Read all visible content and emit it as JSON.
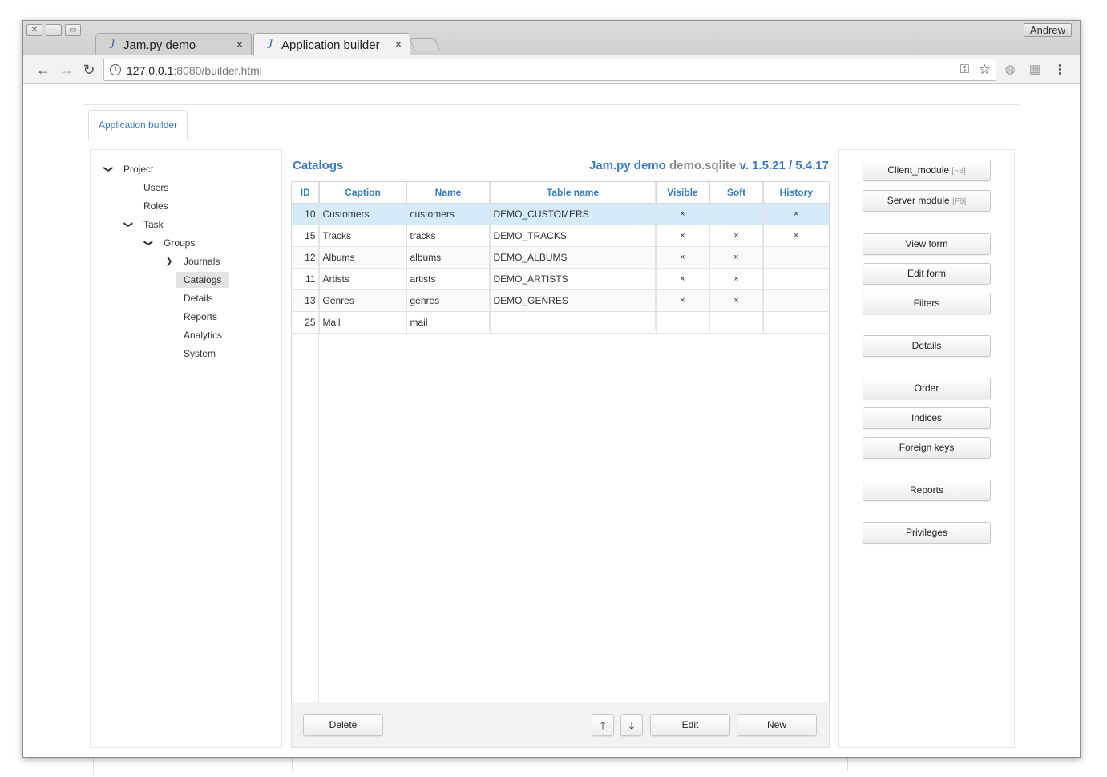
{
  "browser": {
    "profile_name": "Andrew",
    "tabs": [
      {
        "icon": "J",
        "title": "Jam.py demo",
        "close": "×"
      },
      {
        "icon": "J",
        "title": "Application builder",
        "close": "×"
      }
    ],
    "url_host": "127.0.0.1",
    "url_rest": ":8080/builder.html"
  },
  "app": {
    "tab_label": "Application builder",
    "tree": {
      "project": "Project",
      "users": "Users",
      "roles": "Roles",
      "task": "Task",
      "groups": "Groups",
      "journals": "Journals",
      "catalogs": "Catalogs",
      "details": "Details",
      "reports": "Reports",
      "analytics": "Analytics",
      "system": "System"
    },
    "center": {
      "title": "Catalogs",
      "project_name": "Jam.py demo",
      "db_name": "demo.sqlite",
      "version": "v. 1.5.21 / 5.4.17"
    },
    "table": {
      "columns": [
        "ID",
        "Caption",
        "Name",
        "Table name",
        "Visible",
        "Soft",
        "History"
      ],
      "rows": [
        {
          "id": "10",
          "caption": "Customers",
          "name": "customers",
          "table_name": "DEMO_CUSTOMERS",
          "visible": "×",
          "soft": "",
          "history": "×"
        },
        {
          "id": "15",
          "caption": "Tracks",
          "name": "tracks",
          "table_name": "DEMO_TRACKS",
          "visible": "×",
          "soft": "×",
          "history": "×"
        },
        {
          "id": "12",
          "caption": "Albums",
          "name": "albums",
          "table_name": "DEMO_ALBUMS",
          "visible": "×",
          "soft": "×",
          "history": ""
        },
        {
          "id": "11",
          "caption": "Artists",
          "name": "artists",
          "table_name": "DEMO_ARTISTS",
          "visible": "×",
          "soft": "×",
          "history": ""
        },
        {
          "id": "13",
          "caption": "Genres",
          "name": "genres",
          "table_name": "DEMO_GENRES",
          "visible": "×",
          "soft": "×",
          "history": ""
        },
        {
          "id": "25",
          "caption": "Mail",
          "name": "mail",
          "table_name": "",
          "visible": "",
          "soft": "",
          "history": ""
        }
      ],
      "selected_row": 0
    },
    "footer": {
      "delete": "Delete",
      "up": "🡑",
      "down": "🡓",
      "edit": "Edit",
      "new": "New"
    },
    "right": {
      "client_module": "Client_module",
      "client_module_hint": "[F8]",
      "server_module": "Server module",
      "server_module_hint": "[F9]",
      "view_form": "View form",
      "edit_form": "Edit form",
      "filters": "Filters",
      "details": "Details",
      "order": "Order",
      "indices": "Indices",
      "foreign_keys": "Foreign keys",
      "reports": "Reports",
      "privileges": "Privileges"
    }
  },
  "colors": {
    "accent": "#3a7bbf",
    "selected_row": "#d5ebf9",
    "tree_selected": "#e3e3e3"
  }
}
